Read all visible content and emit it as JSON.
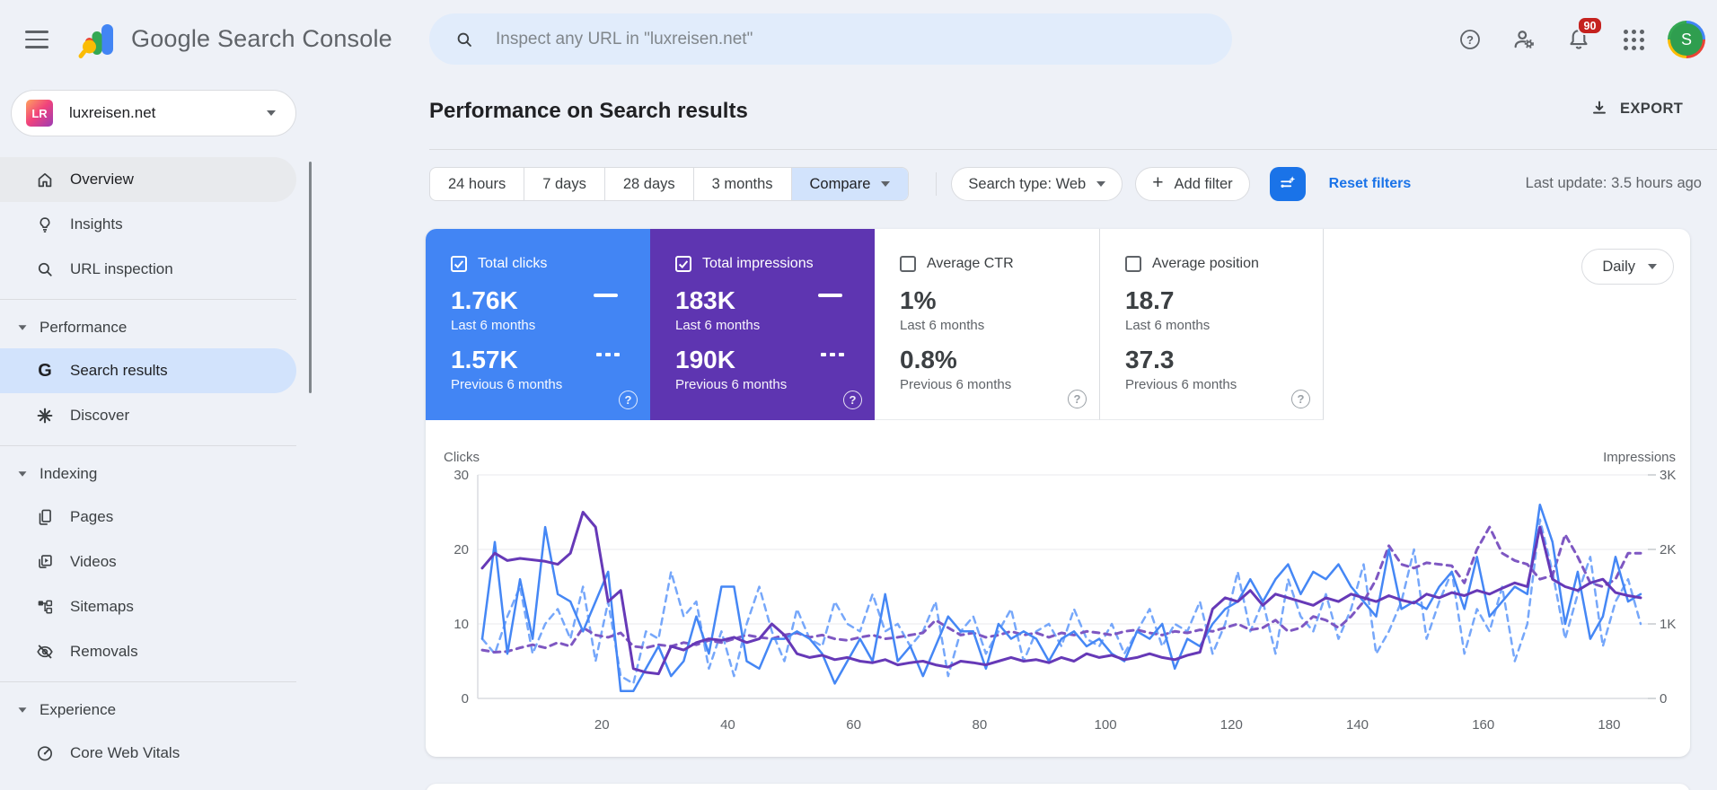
{
  "topbar": {
    "product_name": "Google Search Console",
    "search_placeholder": "Inspect any URL in \"luxreisen.net\"",
    "notification_count": "90",
    "avatar_letter": "S"
  },
  "property": {
    "name": "luxreisen.net",
    "favicon_text": "LR"
  },
  "sidebar": {
    "items": [
      {
        "label": "Overview",
        "icon": "home",
        "state": "highlighted"
      },
      {
        "label": "Insights",
        "icon": "lightbulb"
      },
      {
        "label": "URL inspection",
        "icon": "search"
      },
      {
        "label": "Performance",
        "icon": "caret-down",
        "type": "section"
      },
      {
        "label": "Search results",
        "icon": "google-g",
        "state": "selected"
      },
      {
        "label": "Discover",
        "icon": "asterisk"
      },
      {
        "label": "Indexing",
        "icon": "caret-down",
        "type": "section"
      },
      {
        "label": "Pages",
        "icon": "pages"
      },
      {
        "label": "Videos",
        "icon": "video"
      },
      {
        "label": "Sitemaps",
        "icon": "sitemap"
      },
      {
        "label": "Removals",
        "icon": "eye-off"
      },
      {
        "label": "Experience",
        "icon": "caret-down",
        "type": "section"
      },
      {
        "label": "Core Web Vitals",
        "icon": "gauge"
      }
    ]
  },
  "page": {
    "title": "Performance on Search results",
    "export_label": "EXPORT",
    "last_update": "Last update: 3.5 hours ago"
  },
  "filters": {
    "date_ranges": [
      "24 hours",
      "7 days",
      "28 days",
      "3 months"
    ],
    "compare_label": "Compare",
    "search_type_label": "Search type: Web",
    "add_filter_label": "Add filter",
    "reset_label": "Reset filters"
  },
  "granularity": {
    "label": "Daily"
  },
  "glyphs": {
    "caret_down": "▾",
    "plus": "+",
    "question": "?",
    "g_letter": "G"
  },
  "cards": [
    {
      "label": "Total clicks",
      "checked": true,
      "color": "#4285f4",
      "current": "1.76K",
      "current_period": "Last 6 months",
      "previous": "1.57K",
      "previous_period": "Previous 6 months"
    },
    {
      "label": "Total impressions",
      "checked": true,
      "color": "#5e35b1",
      "current": "183K",
      "current_period": "Last 6 months",
      "previous": "190K",
      "previous_period": "Previous 6 months"
    },
    {
      "label": "Average CTR",
      "checked": false,
      "color": "",
      "current": "1%",
      "current_period": "Last 6 months",
      "previous": "0.8%",
      "previous_period": "Previous 6 months"
    },
    {
      "label": "Average position",
      "checked": false,
      "color": "",
      "current": "18.7",
      "current_period": "Last 6 months",
      "previous": "37.3",
      "previous_period": "Previous 6 months"
    }
  ],
  "chart_data": {
    "type": "line",
    "x_day_range": [
      1,
      185
    ],
    "x_day_step_per_point": 2,
    "x_label_ticks": [
      20,
      40,
      60,
      80,
      100,
      120,
      140,
      160,
      180
    ],
    "axes": {
      "left": {
        "label": "Clicks",
        "ticks": [
          "0",
          "10",
          "20",
          "30"
        ],
        "max": 30
      },
      "right": {
        "label": "Impressions",
        "ticks": [
          "0",
          "1K",
          "2K",
          "3K"
        ],
        "max": 3
      }
    },
    "grid": true,
    "series": [
      {
        "name": "Clicks — Last 6 months",
        "axis": "left",
        "style": "solid",
        "color": "#4587f5",
        "values": [
          8,
          21,
          6,
          16,
          8,
          23,
          14,
          13,
          9,
          13,
          17,
          1,
          1,
          4,
          7,
          3,
          5,
          11,
          6,
          15,
          15,
          5,
          4,
          8,
          8,
          9,
          8,
          6,
          2,
          5,
          8,
          5,
          14,
          5,
          7,
          3,
          7,
          11,
          9,
          9,
          4,
          10,
          8,
          9,
          8,
          5,
          8,
          9,
          7,
          8,
          6,
          5,
          9,
          8,
          10,
          4,
          8,
          7,
          10,
          12,
          13,
          16,
          13,
          16,
          18,
          14,
          17,
          16,
          18,
          15,
          13,
          11,
          20,
          12,
          13,
          12,
          15,
          17,
          12,
          19,
          11,
          13,
          15,
          14,
          26,
          21,
          10,
          17,
          8,
          11,
          19,
          13,
          14
        ]
      },
      {
        "name": "Clicks — Previous 6 months",
        "axis": "left",
        "style": "dashed",
        "color": "#76a7fa",
        "values": [
          8,
          6,
          11,
          15,
          6,
          10,
          12,
          8,
          15,
          5,
          13,
          3,
          2,
          9,
          8,
          17,
          11,
          13,
          4,
          9,
          3,
          10,
          15,
          9,
          5,
          12,
          8,
          7,
          13,
          10,
          9,
          14,
          9,
          10,
          7,
          9,
          13,
          3,
          9,
          11,
          6,
          9,
          12,
          5,
          9,
          10,
          7,
          12,
          8,
          7,
          10,
          6,
          9,
          12,
          7,
          10,
          9,
          13,
          6,
          10,
          17,
          9,
          13,
          6,
          16,
          11,
          9,
          14,
          8,
          12,
          18,
          6,
          9,
          13,
          20,
          8,
          13,
          17,
          6,
          12,
          9,
          15,
          5,
          10,
          24,
          17,
          8,
          14,
          19,
          7,
          13,
          16,
          10
        ]
      },
      {
        "name": "Impressions — Last 6 months",
        "axis": "right",
        "style": "solid",
        "color": "#6639b7",
        "values": [
          1.75,
          1.95,
          1.85,
          1.88,
          1.86,
          1.84,
          1.8,
          1.95,
          2.5,
          2.3,
          1.3,
          1.45,
          0.4,
          0.35,
          0.33,
          0.7,
          0.65,
          0.75,
          0.8,
          0.78,
          0.82,
          0.75,
          0.8,
          1.0,
          0.85,
          0.6,
          0.55,
          0.58,
          0.52,
          0.55,
          0.5,
          0.48,
          0.52,
          0.45,
          0.48,
          0.5,
          0.45,
          0.42,
          0.5,
          0.48,
          0.45,
          0.5,
          0.55,
          0.5,
          0.52,
          0.48,
          0.55,
          0.5,
          0.6,
          0.55,
          0.58,
          0.52,
          0.55,
          0.6,
          0.55,
          0.52,
          0.58,
          0.62,
          1.2,
          1.35,
          1.3,
          1.45,
          1.25,
          1.4,
          1.35,
          1.3,
          1.25,
          1.35,
          1.3,
          1.4,
          1.35,
          1.3,
          1.38,
          1.32,
          1.28,
          1.4,
          1.35,
          1.42,
          1.38,
          1.45,
          1.4,
          1.48,
          1.55,
          1.5,
          2.3,
          1.6,
          1.5,
          1.45,
          1.55,
          1.6,
          1.42,
          1.38,
          1.35
        ]
      },
      {
        "name": "Impressions — Previous 6 months",
        "axis": "right",
        "style": "dashed",
        "color": "#7e57c2",
        "values": [
          0.65,
          0.62,
          0.63,
          0.68,
          0.72,
          0.68,
          0.75,
          0.7,
          0.95,
          0.85,
          0.82,
          0.88,
          0.7,
          0.68,
          0.72,
          0.7,
          0.75,
          0.72,
          0.78,
          0.75,
          0.8,
          0.85,
          0.82,
          0.8,
          0.85,
          0.88,
          0.82,
          0.85,
          0.8,
          0.78,
          0.82,
          0.85,
          0.8,
          0.82,
          0.85,
          0.88,
          1.05,
          0.95,
          0.85,
          0.88,
          0.82,
          0.85,
          0.9,
          0.85,
          0.88,
          0.82,
          0.88,
          0.85,
          0.9,
          0.88,
          0.85,
          0.9,
          0.92,
          0.88,
          0.85,
          0.9,
          0.88,
          0.92,
          0.9,
          0.95,
          1.0,
          0.92,
          0.95,
          1.05,
          0.9,
          0.95,
          1.1,
          1.05,
          0.95,
          1.1,
          1.3,
          1.6,
          2.05,
          1.8,
          1.75,
          1.82,
          1.8,
          1.78,
          1.55,
          2.0,
          2.3,
          1.95,
          1.85,
          1.8,
          1.6,
          1.65,
          2.2,
          1.9,
          1.55,
          1.5,
          1.6,
          1.95,
          1.95
        ]
      }
    ]
  }
}
